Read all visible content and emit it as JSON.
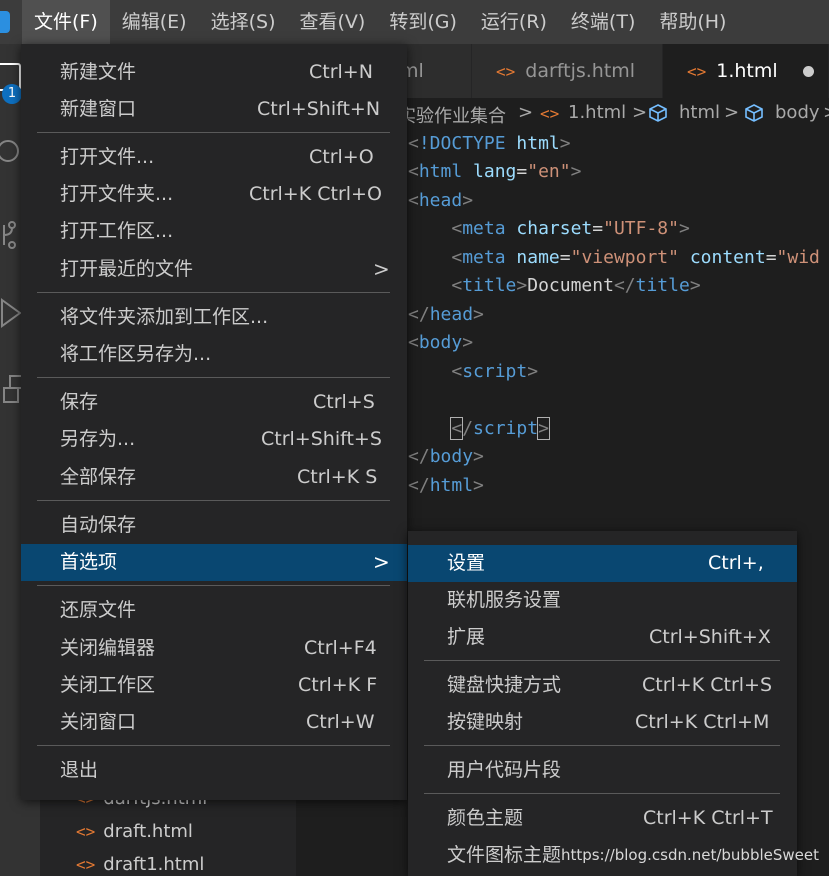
{
  "menubar": {
    "items": [
      "文件(F)",
      "编辑(E)",
      "选择(S)",
      "查看(V)",
      "转到(G)",
      "运行(R)",
      "终端(T)",
      "帮助(H)"
    ]
  },
  "activity": {
    "badge": "1"
  },
  "tabs": [
    {
      "label": "ml"
    },
    {
      "label": "darftjs.html",
      "icon": "<>"
    },
    {
      "label": "1.html",
      "icon": "<>"
    }
  ],
  "breadcrumb": {
    "items": [
      "实验作业集合",
      "1.html",
      "html",
      "body"
    ],
    "separator": ">"
  },
  "code": {
    "doctype": "!DOCTYPE",
    "html": "html",
    "lang_attr": "lang",
    "lang_val": "\"en\"",
    "head": "head",
    "meta": "meta",
    "charset_attr": "charset",
    "charset_val": "\"UTF-8\"",
    "name_attr": "name",
    "name_val": "\"viewport\"",
    "content_attr": "content",
    "content_val": "\"wid",
    "title": "title",
    "title_text": "Document",
    "body": "body",
    "script": "script"
  },
  "file_menu": {
    "new_file": {
      "label": "新建文件",
      "shortcut": "Ctrl+N"
    },
    "new_window": {
      "label": "新建窗口",
      "shortcut": "Ctrl+Shift+N"
    },
    "open_file": {
      "label": "打开文件...",
      "shortcut": "Ctrl+O"
    },
    "open_folder": {
      "label": "打开文件夹...",
      "shortcut": "Ctrl+K Ctrl+O"
    },
    "open_workspace": {
      "label": "打开工作区..."
    },
    "open_recent": {
      "label": "打开最近的文件",
      "arrow": ">"
    },
    "add_folder": {
      "label": "将文件夹添加到工作区..."
    },
    "save_workspace_as": {
      "label": "将工作区另存为..."
    },
    "save": {
      "label": "保存",
      "shortcut": "Ctrl+S"
    },
    "save_as": {
      "label": "另存为...",
      "shortcut": "Ctrl+Shift+S"
    },
    "save_all": {
      "label": "全部保存",
      "shortcut": "Ctrl+K S"
    },
    "auto_save": {
      "label": "自动保存"
    },
    "preferences": {
      "label": "首选项",
      "arrow": ">"
    },
    "revert_file": {
      "label": "还原文件"
    },
    "close_editor": {
      "label": "关闭编辑器",
      "shortcut": "Ctrl+F4"
    },
    "close_workspace": {
      "label": "关闭工作区",
      "shortcut": "Ctrl+K F"
    },
    "close_window": {
      "label": "关闭窗口",
      "shortcut": "Ctrl+W"
    },
    "exit": {
      "label": "退出"
    }
  },
  "submenu": {
    "settings": {
      "label": "设置",
      "shortcut": "Ctrl+,"
    },
    "online_services": {
      "label": "联机服务设置"
    },
    "extensions": {
      "label": "扩展",
      "shortcut": "Ctrl+Shift+X"
    },
    "keyboard_shortcuts": {
      "label": "键盘快捷方式",
      "shortcut": "Ctrl+K Ctrl+S"
    },
    "keymaps": {
      "label": "按键映射",
      "shortcut": "Ctrl+K Ctrl+M"
    },
    "user_snippets": {
      "label": "用户代码片段"
    },
    "color_theme": {
      "label": "颜色主题",
      "shortcut": "Ctrl+K Ctrl+T"
    },
    "file_icon_theme": {
      "label": "文件图标主题"
    }
  },
  "explorer": {
    "files": [
      "darftjs.html",
      "draft.html",
      "draft1.html"
    ],
    "file_icon": "<>"
  },
  "watermark": "https://blog.csdn.net/bubbleSweet",
  "colors": {
    "menu_bg": "#252526",
    "selected_bg": "#094771",
    "menubar_bg": "#3c3c3c",
    "html_icon": "#e37933"
  }
}
